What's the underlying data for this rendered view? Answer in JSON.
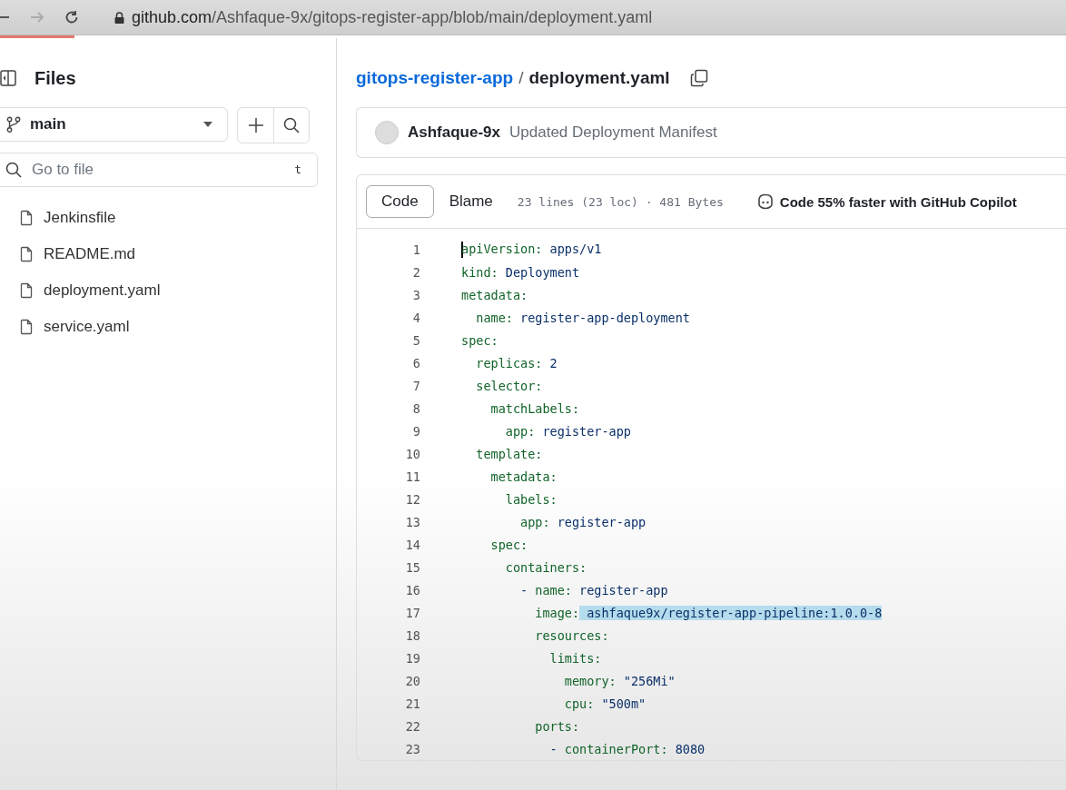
{
  "browser": {
    "url_host": "github.com",
    "url_path": "/Ashfaque-9x/gitops-register-app/blob/main/deployment.yaml"
  },
  "sidebar": {
    "title": "Files",
    "branch": "main",
    "search": {
      "placeholder": "Go to file",
      "shortcut": "t"
    },
    "files": [
      {
        "name": "Jenkinsfile",
        "selected": false
      },
      {
        "name": "README.md",
        "selected": false
      },
      {
        "name": "deployment.yaml",
        "selected": false
      },
      {
        "name": "service.yaml",
        "selected": false
      }
    ]
  },
  "breadcrumb": {
    "repo": "gitops-register-app",
    "separator": "/",
    "file": "deployment.yaml"
  },
  "commit": {
    "author": "Ashfaque-9x",
    "message": "Updated Deployment Manifest"
  },
  "toolbar": {
    "tabs": [
      {
        "label": "Code",
        "selected": true
      },
      {
        "label": "Blame",
        "selected": false
      }
    ],
    "info": "23 lines (23 loc) · 481 Bytes",
    "copilot": "Code 55% faster with GitHub Copilot"
  },
  "code": [
    {
      "n": "1",
      "text": "apiVersion: apps/v1",
      "highlighted": false
    },
    {
      "n": "2",
      "text": "kind: Deployment",
      "highlighted": false
    },
    {
      "n": "3",
      "text": "metadata:",
      "highlighted": false
    },
    {
      "n": "4",
      "text": "  name: register-app-deployment",
      "highlighted": false
    },
    {
      "n": "5",
      "text": "spec:",
      "highlighted": false
    },
    {
      "n": "6",
      "text": "  replicas: 2",
      "highlighted": false
    },
    {
      "n": "7",
      "text": "  selector:",
      "highlighted": false
    },
    {
      "n": "8",
      "text": "    matchLabels:",
      "highlighted": false
    },
    {
      "n": "9",
      "text": "      app: register-app",
      "highlighted": false
    },
    {
      "n": "10",
      "text": "  template:",
      "highlighted": false
    },
    {
      "n": "11",
      "text": "    metadata:",
      "highlighted": false
    },
    {
      "n": "12",
      "text": "      labels:",
      "highlighted": false
    },
    {
      "n": "13",
      "text": "        app: register-app",
      "highlighted": false
    },
    {
      "n": "14",
      "text": "    spec:",
      "highlighted": false
    },
    {
      "n": "15",
      "text": "      containers:",
      "highlighted": false
    },
    {
      "n": "16",
      "text": "        - name: register-app",
      "highlighted": false
    },
    {
      "n": "17",
      "text": "          image: ashfaque9x/register-app-pipeline:1.0.0-8",
      "highlighted": true
    },
    {
      "n": "18",
      "text": "          resources:",
      "highlighted": false
    },
    {
      "n": "19",
      "text": "            limits:",
      "highlighted": false
    },
    {
      "n": "20",
      "text": "              memory: \"256Mi\"",
      "highlighted": false
    },
    {
      "n": "21",
      "text": "              cpu: \"500m\"",
      "highlighted": false
    },
    {
      "n": "22",
      "text": "          ports:",
      "highlighted": false
    },
    {
      "n": "23",
      "text": "            - containerPort: 8080",
      "highlighted": false
    }
  ]
}
